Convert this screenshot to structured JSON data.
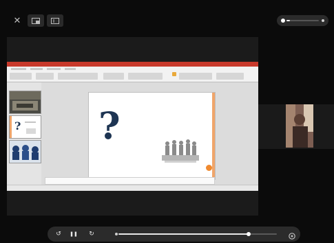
{
  "status_bar": {
    "left_text": "",
    "right_text": ""
  },
  "top_controls": {
    "close_glyph": "✕",
    "icons": [
      "close-icon",
      "picture-in-picture-icon",
      "aspect-ratio-icon"
    ]
  },
  "volume": {
    "level": 0.1,
    "icon": "volume-icon"
  },
  "slide": {
    "title": "",
    "symbol": "?"
  },
  "playback": {
    "rewind_glyph": "↺",
    "pause_glyph": "❚❚",
    "forward_glyph": "↻",
    "progress": 0.82,
    "settings_icon": "settings-icon"
  },
  "colors": {
    "ppt_brand": "#c8392b",
    "question_mark": "#1e3553",
    "slide_accent": "#f08a30"
  }
}
